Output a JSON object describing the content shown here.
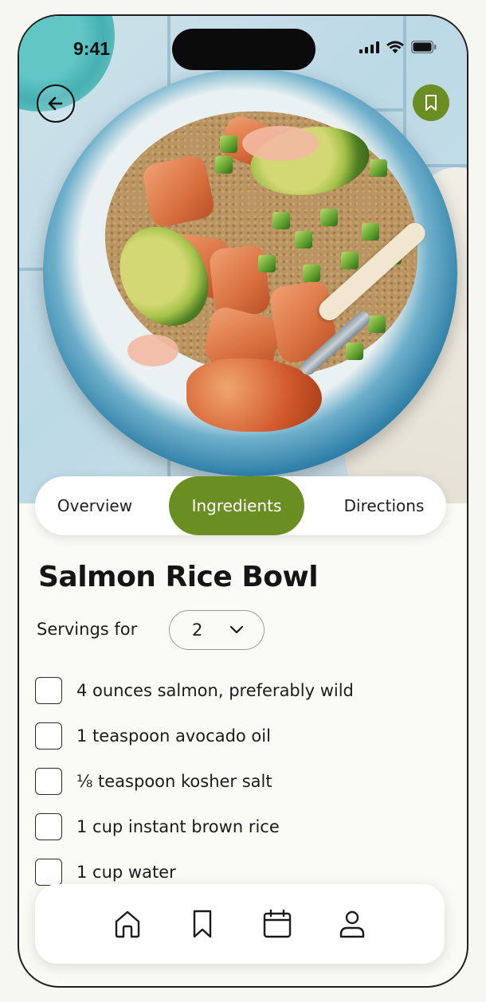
{
  "status_bar": {
    "time": "9:41"
  },
  "recipe": {
    "title": "Salmon Rice Bowl"
  },
  "tabs": [
    {
      "label": "Overview",
      "active": false
    },
    {
      "label": "Ingredients",
      "active": true
    },
    {
      "label": "Directions",
      "active": false
    }
  ],
  "servings": {
    "label": "Servings for",
    "value": "2"
  },
  "ingredients": [
    {
      "text": "4 ounces salmon, preferably wild",
      "checked": false
    },
    {
      "text": "1 teaspoon avocado oil",
      "checked": false
    },
    {
      "text": "⅛ teaspoon kosher salt",
      "checked": false
    },
    {
      "text": "1 cup instant brown rice",
      "checked": false
    },
    {
      "text": "1 cup water",
      "checked": false
    }
  ],
  "bottom_nav": [
    "home-icon",
    "bookmark-icon",
    "calendar-icon",
    "profile-icon"
  ],
  "colors": {
    "accent": "#6b8e23",
    "background": "#fbfbf6"
  }
}
